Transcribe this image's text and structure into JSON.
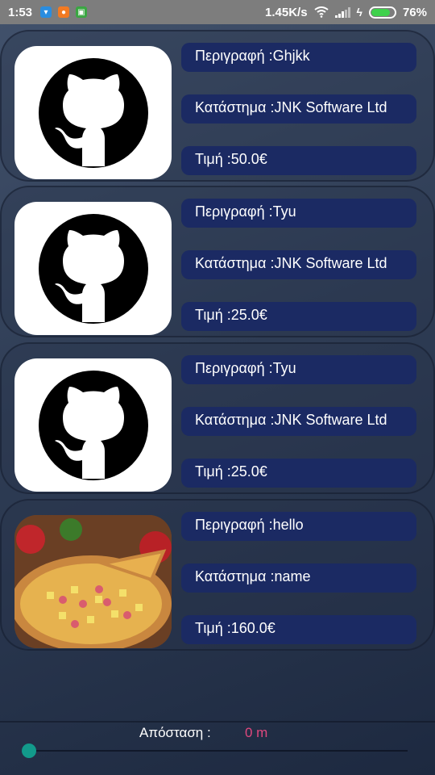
{
  "status_bar": {
    "time": "1:53",
    "speed": "1.45K/s",
    "battery": "76%",
    "battery_level": 0.76,
    "icons": [
      "shield-app-icon",
      "orange-app-icon",
      "green-app-icon",
      "wifi-icon",
      "signal-icon",
      "charging-icon",
      "battery-icon"
    ]
  },
  "items": [
    {
      "image": "github-logo",
      "description": "Περιγραφή :Ghjkk",
      "store": "Κατάστημα :JNK Software Ltd",
      "price": "Τιμή :50.0€"
    },
    {
      "image": "github-logo",
      "description": "Περιγραφή :Tyu",
      "store": "Κατάστημα :JNK Software Ltd",
      "price": "Τιμή :25.0€"
    },
    {
      "image": "github-logo",
      "description": "Περιγραφή :Tyu",
      "store": "Κατάστημα :JNK Software Ltd",
      "price": "Τιμή :25.0€"
    },
    {
      "image": "pizza-photo",
      "description": "Περιγραφή :hello",
      "store": "Κατάστημα :name",
      "price": "Τιμή :160.0€"
    }
  ],
  "footer": {
    "distance_label": "Απόσταση :",
    "distance_value": "0 m",
    "slider_value": 0
  },
  "colors": {
    "field_bg": "#1b2a63",
    "accent_pink": "#e0487e",
    "slider_thumb": "#129a8b"
  }
}
